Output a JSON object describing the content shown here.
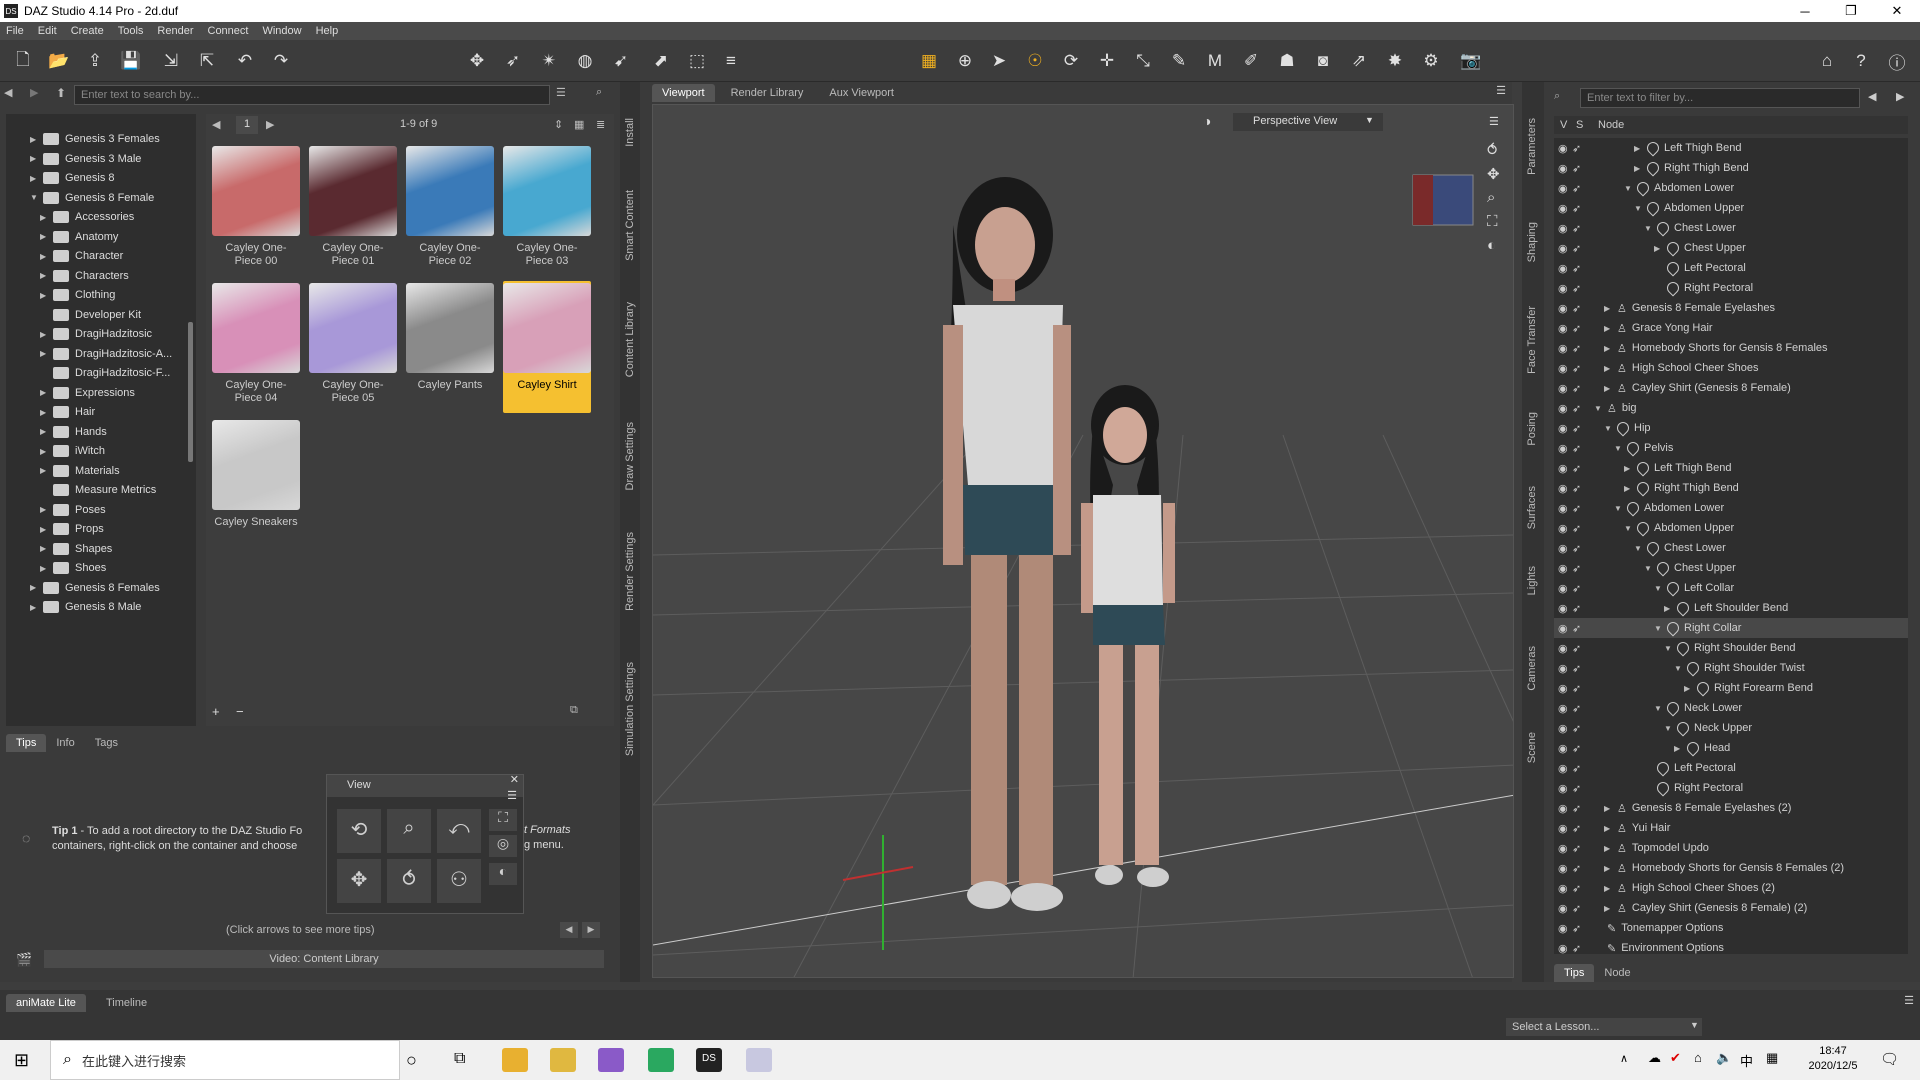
{
  "window": {
    "title": "DAZ Studio 4.14 Pro - 2d.duf"
  },
  "menu": [
    "File",
    "Edit",
    "Create",
    "Tools",
    "Render",
    "Connect",
    "Window",
    "Help"
  ],
  "content": {
    "search_placeholder": "Enter text to search by...",
    "page_num": "1",
    "count": "1-9 of 9",
    "tree": [
      {
        "label": "Genesis 3 Females",
        "indent": 0,
        "arrow": "▶"
      },
      {
        "label": "Genesis 3 Male",
        "indent": 0,
        "arrow": "▶"
      },
      {
        "label": "Genesis 8",
        "indent": 0,
        "arrow": "▶"
      },
      {
        "label": "Genesis 8 Female",
        "indent": 0,
        "arrow": "▼"
      },
      {
        "label": "Accessories",
        "indent": 1,
        "arrow": "▶"
      },
      {
        "label": "Anatomy",
        "indent": 1,
        "arrow": "▶"
      },
      {
        "label": "Character",
        "indent": 1,
        "arrow": "▶"
      },
      {
        "label": "Characters",
        "indent": 1,
        "arrow": "▶"
      },
      {
        "label": "Clothing",
        "indent": 1,
        "arrow": "▶"
      },
      {
        "label": "Developer Kit",
        "indent": 1,
        "arrow": ""
      },
      {
        "label": "DragiHadzitosic",
        "indent": 1,
        "arrow": "▶"
      },
      {
        "label": "DragiHadzitosic-A...",
        "indent": 1,
        "arrow": "▶"
      },
      {
        "label": "DragiHadzitosic-F...",
        "indent": 1,
        "arrow": ""
      },
      {
        "label": "Expressions",
        "indent": 1,
        "arrow": "▶"
      },
      {
        "label": "Hair",
        "indent": 1,
        "arrow": "▶"
      },
      {
        "label": "Hands",
        "indent": 1,
        "arrow": "▶"
      },
      {
        "label": "iWitch",
        "indent": 1,
        "arrow": "▶"
      },
      {
        "label": "Materials",
        "indent": 1,
        "arrow": "▶"
      },
      {
        "label": "Measure Metrics",
        "indent": 1,
        "arrow": ""
      },
      {
        "label": "Poses",
        "indent": 1,
        "arrow": "▶"
      },
      {
        "label": "Props",
        "indent": 1,
        "arrow": "▶"
      },
      {
        "label": "Shapes",
        "indent": 1,
        "arrow": "▶"
      },
      {
        "label": "Shoes",
        "indent": 1,
        "arrow": "▶"
      },
      {
        "label": "Genesis 8 Females",
        "indent": 0,
        "arrow": "▶"
      },
      {
        "label": "Genesis 8 Male",
        "indent": 0,
        "arrow": "▶"
      }
    ],
    "items": [
      {
        "label": "Cayley One-Piece 00",
        "color": "#c86a6a"
      },
      {
        "label": "Cayley One-Piece 01",
        "color": "#5a2a30"
      },
      {
        "label": "Cayley One-Piece 02",
        "color": "#3a7ab8"
      },
      {
        "label": "Cayley One-Piece 03",
        "color": "#48a8d0"
      },
      {
        "label": "Cayley One-Piece 04",
        "color": "#d890b8"
      },
      {
        "label": "Cayley One-Piece 05",
        "color": "#a898d8"
      },
      {
        "label": "Cayley Pants",
        "color": "#8a8a8a"
      },
      {
        "label": "Cayley Shirt",
        "color": "#d8a0b8"
      },
      {
        "label": "Cayley Sneakers",
        "color": "#c8c8c8"
      }
    ],
    "selected_color": "#f5c030"
  },
  "tips": {
    "tabs": [
      "Tips",
      "Info",
      "Tags"
    ],
    "text_prefix": "Tip 1",
    "text": " - To add a root directory to the DAZ Studio Fo",
    "text2": "containers, right-click on the container and choose",
    "text3": "t Formats",
    "text4": "g menu.",
    "hint": "(Click arrows to see more tips)",
    "video": "Video: Content Library"
  },
  "view_panel": {
    "title": "View"
  },
  "viewport": {
    "tabs": [
      "Viewport",
      "Render Library",
      "Aux Viewport"
    ],
    "camera": "Perspective View"
  },
  "side_tabs_left": [
    "Install",
    "Smart Content",
    "Content Library",
    "Draw Settings",
    "Render Settings",
    "Simulation Settings"
  ],
  "side_tabs_right": [
    "Parameters",
    "Shaping",
    "Face Transfer",
    "Posing",
    "Surfaces",
    "Lights",
    "Cameras",
    "Scene"
  ],
  "scene": {
    "filter_placeholder": "Enter text to filter by...",
    "col_v": "V",
    "col_s": "S",
    "col_node": "Node",
    "rows": [
      {
        "label": "Left Thigh Bend",
        "indent": 4,
        "arrow": "▶",
        "type": "bone"
      },
      {
        "label": "Right Thigh Bend",
        "indent": 4,
        "arrow": "▶",
        "type": "bone"
      },
      {
        "label": "Abdomen Lower",
        "indent": 3,
        "arrow": "▼",
        "type": "bone"
      },
      {
        "label": "Abdomen Upper",
        "indent": 4,
        "arrow": "▼",
        "type": "bone"
      },
      {
        "label": "Chest Lower",
        "indent": 5,
        "arrow": "▼",
        "type": "bone"
      },
      {
        "label": "Chest Upper",
        "indent": 6,
        "arrow": "▶",
        "type": "bone"
      },
      {
        "label": "Left Pectoral",
        "indent": 6,
        "arrow": "",
        "type": "bone"
      },
      {
        "label": "Right Pectoral",
        "indent": 6,
        "arrow": "",
        "type": "bone"
      },
      {
        "label": "Genesis 8 Female Eyelashes",
        "indent": 1,
        "arrow": "▶",
        "type": "fig"
      },
      {
        "label": "Grace Yong Hair",
        "indent": 1,
        "arrow": "▶",
        "type": "fig"
      },
      {
        "label": "Homebody Shorts for Gensis 8 Females",
        "indent": 1,
        "arrow": "▶",
        "type": "fig"
      },
      {
        "label": "High School Cheer Shoes",
        "indent": 1,
        "arrow": "▶",
        "type": "fig"
      },
      {
        "label": "Cayley Shirt (Genesis 8 Female)",
        "indent": 1,
        "arrow": "▶",
        "type": "fig"
      },
      {
        "label": "big",
        "indent": 0,
        "arrow": "▼",
        "type": "fig"
      },
      {
        "label": "Hip",
        "indent": 1,
        "arrow": "▼",
        "type": "bone"
      },
      {
        "label": "Pelvis",
        "indent": 2,
        "arrow": "▼",
        "type": "bone"
      },
      {
        "label": "Left Thigh Bend",
        "indent": 3,
        "arrow": "▶",
        "type": "bone"
      },
      {
        "label": "Right Thigh Bend",
        "indent": 3,
        "arrow": "▶",
        "type": "bone"
      },
      {
        "label": "Abdomen Lower",
        "indent": 2,
        "arrow": "▼",
        "type": "bone"
      },
      {
        "label": "Abdomen Upper",
        "indent": 3,
        "arrow": "▼",
        "type": "bone"
      },
      {
        "label": "Chest Lower",
        "indent": 4,
        "arrow": "▼",
        "type": "bone"
      },
      {
        "label": "Chest Upper",
        "indent": 5,
        "arrow": "▼",
        "type": "bone"
      },
      {
        "label": "Left Collar",
        "indent": 6,
        "arrow": "▼",
        "type": "bone"
      },
      {
        "label": "Left Shoulder Bend",
        "indent": 7,
        "arrow": "▶",
        "type": "bone"
      },
      {
        "label": "Right Collar",
        "indent": 6,
        "arrow": "▼",
        "type": "bone",
        "selected": true
      },
      {
        "label": "Right Shoulder Bend",
        "indent": 7,
        "arrow": "▼",
        "type": "bone"
      },
      {
        "label": "Right Shoulder Twist",
        "indent": 8,
        "arrow": "▼",
        "type": "bone"
      },
      {
        "label": "Right Forearm Bend",
        "indent": 9,
        "arrow": "▶",
        "type": "bone"
      },
      {
        "label": "Neck Lower",
        "indent": 6,
        "arrow": "▼",
        "type": "bone"
      },
      {
        "label": "Neck Upper",
        "indent": 7,
        "arrow": "▼",
        "type": "bone"
      },
      {
        "label": "Head",
        "indent": 8,
        "arrow": "▶",
        "type": "bone"
      },
      {
        "label": "Left Pectoral",
        "indent": 5,
        "arrow": "",
        "type": "bone"
      },
      {
        "label": "Right Pectoral",
        "indent": 5,
        "arrow": "",
        "type": "bone"
      },
      {
        "label": "Genesis 8 Female Eyelashes (2)",
        "indent": 1,
        "arrow": "▶",
        "type": "fig"
      },
      {
        "label": "Yui Hair",
        "indent": 1,
        "arrow": "▶",
        "type": "fig"
      },
      {
        "label": "Topmodel Updo",
        "indent": 1,
        "arrow": "▶",
        "type": "fig"
      },
      {
        "label": "Homebody Shorts for Gensis 8 Females (2)",
        "indent": 1,
        "arrow": "▶",
        "type": "fig"
      },
      {
        "label": "High School Cheer Shoes (2)",
        "indent": 1,
        "arrow": "▶",
        "type": "fig"
      },
      {
        "label": "Cayley Shirt (Genesis 8 Female) (2)",
        "indent": 1,
        "arrow": "▶",
        "type": "fig"
      },
      {
        "label": "Tonemapper Options",
        "indent": 0,
        "arrow": "",
        "type": "opt"
      },
      {
        "label": "Environment Options",
        "indent": 0,
        "arrow": "",
        "type": "opt"
      }
    ],
    "bottom_tabs": [
      "Tips",
      "Node"
    ]
  },
  "bottom": {
    "tabs": [
      "aniMate Lite",
      "Timeline"
    ],
    "lesson": "Select a Lesson..."
  },
  "taskbar": {
    "search": "在此键入进行搜索",
    "time": "18:47",
    "date": "2020/12/5",
    "ime": "中"
  }
}
